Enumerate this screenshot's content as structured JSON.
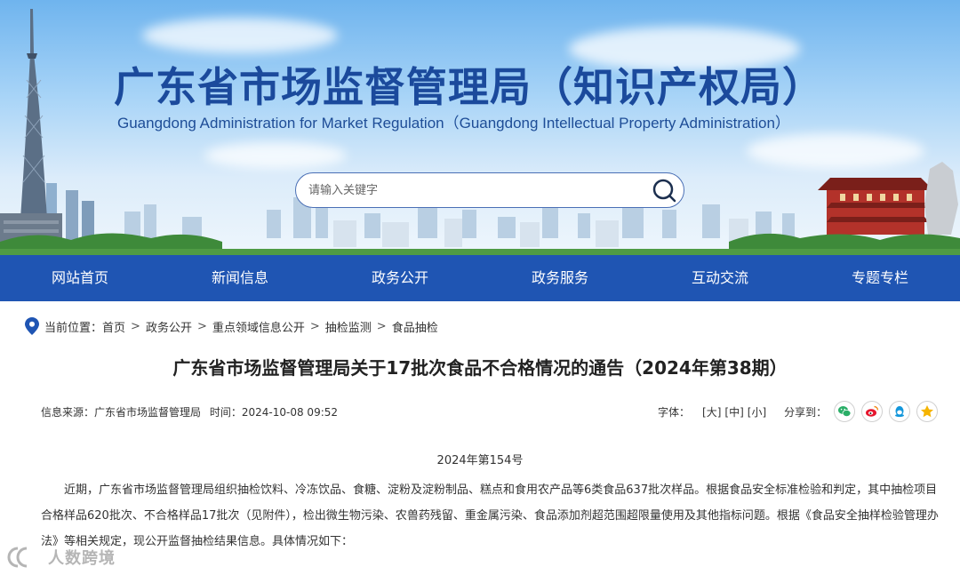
{
  "header": {
    "title": "广东省市场监督管理局（知识产权局）",
    "subtitle": "Guangdong Administration for Market Regulation（Guangdong Intellectual Property Administration）"
  },
  "search": {
    "placeholder": "请输入关键字"
  },
  "nav": {
    "items": [
      {
        "label": "网站首页"
      },
      {
        "label": "新闻信息"
      },
      {
        "label": "政务公开"
      },
      {
        "label": "政务服务"
      },
      {
        "label": "互动交流"
      },
      {
        "label": "专题专栏"
      }
    ]
  },
  "breadcrumb": {
    "prefix": "当前位置：",
    "items": [
      {
        "label": "首页"
      },
      {
        "label": "政务公开"
      },
      {
        "label": "重点领域信息公开"
      },
      {
        "label": "抽检监测"
      },
      {
        "label": "食品抽检"
      }
    ],
    "separator": ">"
  },
  "article": {
    "title": "广东省市场监督管理局关于17批次食品不合格情况的通告（2024年第38期）",
    "source_label": "信息来源：",
    "source": "广东省市场监督管理局",
    "time_label": "时间：",
    "time": "2024-10-08 09:52",
    "font_size_label": "字体：",
    "font_sizes": [
      "[大]",
      "[中]",
      "[小]"
    ],
    "share_label": "分享到：",
    "share_icons": [
      "wechat-icon",
      "weibo-icon",
      "qq-icon",
      "qzone-icon"
    ],
    "doc_number": "2024年第154号",
    "paragraph": "近期，广东省市场监督管理局组织抽检饮料、冷冻饮品、食糖、淀粉及淀粉制品、糕点和食用农产品等6类食品637批次样品。根据食品安全标准检验和判定，其中抽检项目合格样品620批次、不合格样品17批次（见附件），检出微生物污染、农兽药残留、重金属污染、食品添加剂超范围超限量使用及其他指标问题。根据《食品安全抽样检验管理办法》等相关规定，现公开监督抽检结果信息。具体情况如下："
  },
  "watermark": {
    "text": "人数跨境"
  },
  "colors": {
    "nav_bg": "#1f55b3",
    "title_blue": "#1b4a9c",
    "wechat": "#2aae67",
    "weibo": "#e6162d",
    "qq": "#1296db",
    "qzone": "#f5b400"
  }
}
